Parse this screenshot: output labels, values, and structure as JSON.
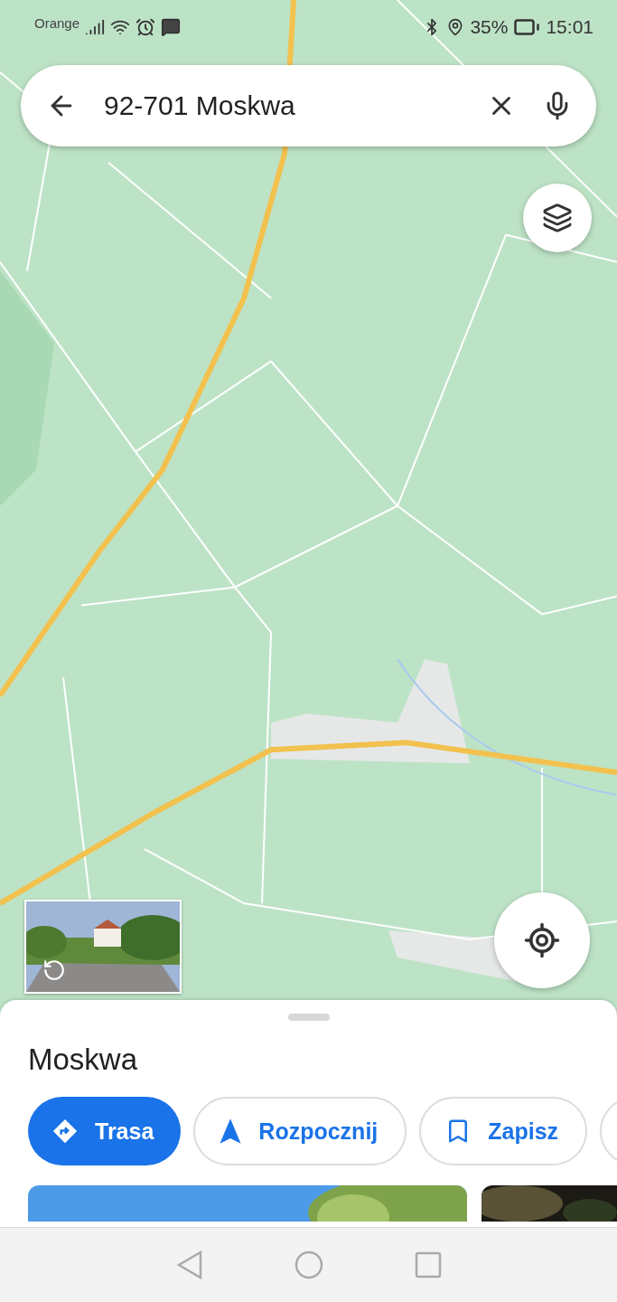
{
  "status_bar": {
    "carrier": "Orange",
    "battery": "35%",
    "time": "15:01"
  },
  "search": {
    "value": "92-701 Moskwa"
  },
  "place": {
    "title": "Moskwa",
    "actions": [
      {
        "label": "Trasa",
        "kind": "primary"
      },
      {
        "label": "Rozpocznij",
        "kind": "outline"
      },
      {
        "label": "Zapisz",
        "kind": "outline"
      }
    ]
  }
}
